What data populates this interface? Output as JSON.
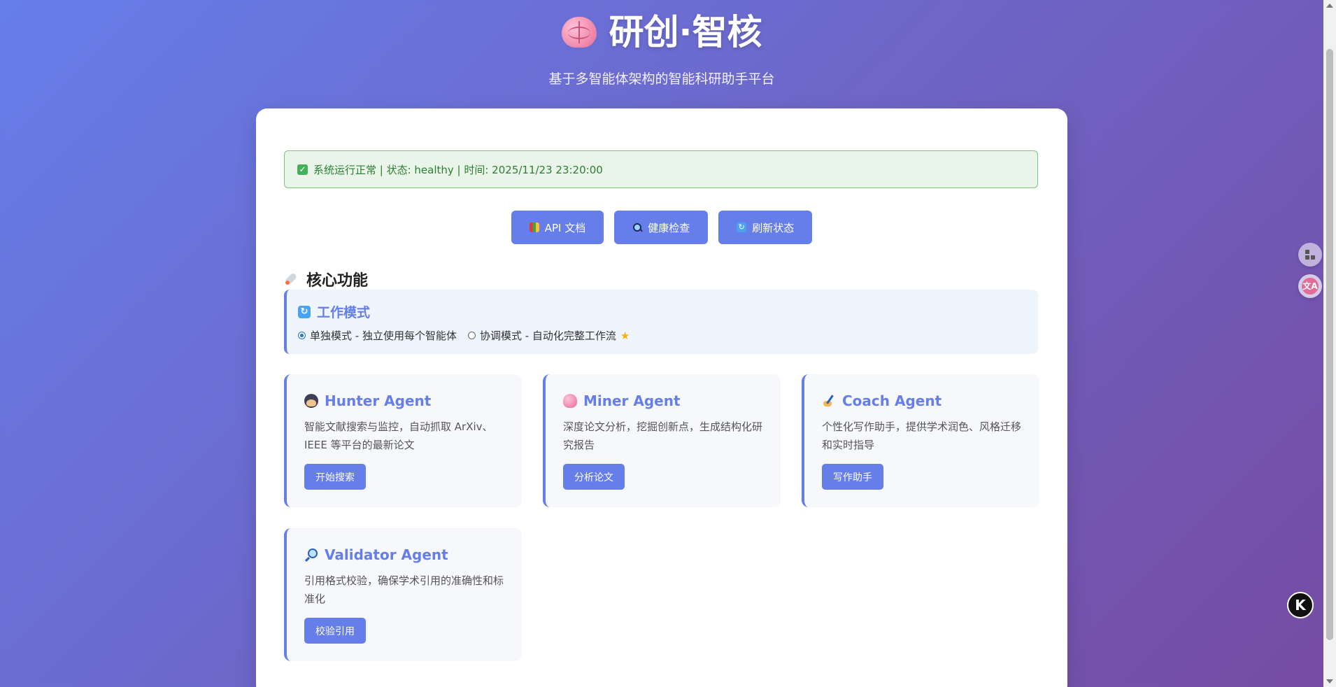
{
  "header": {
    "title": "研创·智核",
    "subtitle": "基于多智能体架构的智能科研助手平台"
  },
  "status": {
    "text": "系统运行正常 | 状态: healthy | 时间: 2025/11/23 23:20:00"
  },
  "actions": {
    "api_docs": "API 文档",
    "health_check": "健康检查",
    "refresh_status": "刷新状态"
  },
  "core": {
    "title": "核心功能"
  },
  "work_mode": {
    "title": "工作模式",
    "options": [
      {
        "label": "单独模式 - 独立使用每个智能体",
        "selected": true
      },
      {
        "label": "协调模式 - 自动化完整工作流",
        "selected": false
      }
    ]
  },
  "agents": [
    {
      "name": "Hunter Agent",
      "icon": "detective-icon",
      "description": "智能文献搜索与监控，自动抓取 ArXiv、IEEE 等平台的最新论文",
      "button": "开始搜索"
    },
    {
      "name": "Miner Agent",
      "icon": "brain-icon",
      "description": "深度论文分析，挖掘创新点，生成结构化研究报告",
      "button": "分析论文"
    },
    {
      "name": "Coach Agent",
      "icon": "writing-hand-icon",
      "description": "个性化写作助手，提供学术润色、风格迁移和实时指导",
      "button": "写作助手"
    },
    {
      "name": "Validator Agent",
      "icon": "magnifier-icon",
      "description": "引用格式校验，确保学术引用的准确性和标准化",
      "button": "校验引用"
    }
  ],
  "floating": {
    "k_label": "K"
  },
  "colors": {
    "accent": "#667eea",
    "gradient_end": "#764ba2",
    "status_text": "#2e7d32"
  }
}
